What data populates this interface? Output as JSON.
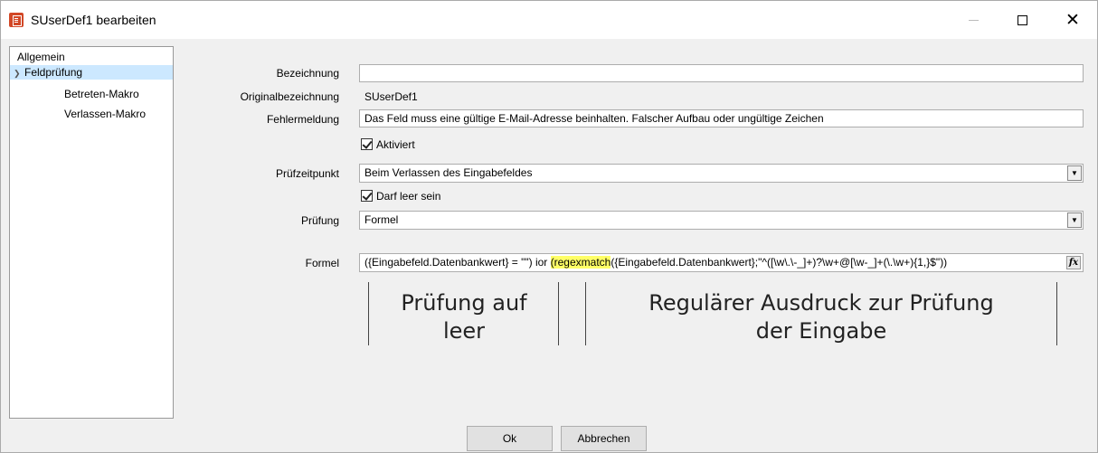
{
  "window": {
    "title": "SUserDef1 bearbeiten",
    "icon": "app-document-icon"
  },
  "tree": {
    "items": [
      {
        "label": "Allgemein",
        "expanded": false,
        "selected": false
      },
      {
        "label": "Feldprüfung",
        "expanded": true,
        "selected": true
      },
      {
        "label": "Betreten-Makro",
        "selected": false
      },
      {
        "label": "Verlassen-Makro",
        "selected": false
      }
    ]
  },
  "form": {
    "bezeichnung": {
      "label": "Bezeichnung",
      "value": ""
    },
    "originalbezeichnung": {
      "label": "Originalbezeichnung",
      "value": "SUserDef1"
    },
    "fehlermeldung": {
      "label": "Fehlermeldung",
      "value": "Das Feld muss eine gültige E-Mail-Adresse beinhalten. Falscher Aufbau oder ungültige Zeichen"
    },
    "aktiviert": {
      "label": "Aktiviert",
      "checked": true
    },
    "pruefzeitpunkt": {
      "label": "Prüfzeitpunkt",
      "value": "Beim Verlassen des Eingabefeldes"
    },
    "darf_leer": {
      "label": "Darf leer sein",
      "checked": true
    },
    "pruefung": {
      "label": "Prüfung",
      "value": "Formel"
    },
    "formel": {
      "label": "Formel",
      "part1": "({Eingabefeld.Datenbankwert} = \"\") ior ",
      "highlight": "(regexmatch",
      "part2": "({Eingabefeld.Datenbankwert};\"^([\\w\\.\\-_]+)?\\w+@[\\w-_]+(\\.\\w+){1,}$\"))",
      "fx_label": "fx"
    }
  },
  "annotations": {
    "left_line1": "Prüfung auf",
    "left_line2": "leer",
    "right_line1": "Regulärer Ausdruck zur Prüfung",
    "right_line2": "der Eingabe"
  },
  "buttons": {
    "ok": "Ok",
    "cancel": "Abbrechen"
  },
  "colors": {
    "highlight": "#ffff66",
    "tree_selection": "#cce8ff",
    "app_icon": "#d24726"
  }
}
